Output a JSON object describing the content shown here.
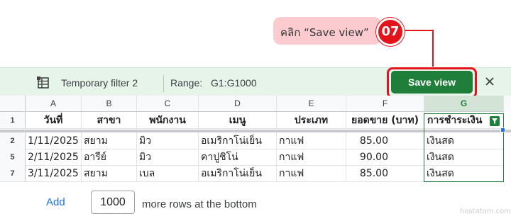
{
  "callout": {
    "text": "คลิก “Save view”",
    "step": "07"
  },
  "filter_bar": {
    "filter_name": "Temporary filter 2",
    "range_label": "Range:",
    "range_value": "G1:G1000",
    "save_label": "Save view"
  },
  "columns": [
    "A",
    "B",
    "C",
    "D",
    "E",
    "F",
    "G"
  ],
  "header_row": {
    "row_number": "1",
    "cells": [
      "วันที่",
      "สาขา",
      "พนักงาน",
      "เมนู",
      "ประเภท",
      "ยอดขาย (บาท)",
      "การชำระเงิน"
    ]
  },
  "rows": [
    {
      "row_number": "2",
      "cells": [
        "1/11/2025",
        "สยาม",
        "มิว",
        "อเมริกาโน่เย็น",
        "กาแฟ",
        "85.00",
        "เงินสด"
      ]
    },
    {
      "row_number": "5",
      "cells": [
        "2/11/2025",
        "อารีย์",
        "มิว",
        "คาปูชิโน่",
        "กาแฟ",
        "90.00",
        "เงินสด"
      ]
    },
    {
      "row_number": "7",
      "cells": [
        "3/11/2025",
        "สยาม",
        "เบล",
        "อเมริกาโน่เย็น",
        "กาแฟ",
        "85.00",
        "เงินสด"
      ]
    }
  ],
  "footer": {
    "add_label": "Add",
    "rows_value": "1000",
    "rows_suffix": "more rows at the bottom"
  },
  "watermark": "hostatom.com",
  "colors": {
    "accent_green": "#1e7e3a",
    "callout_red": "#e3141c",
    "callout_bg": "#fccbcf",
    "filter_bar_bg": "#e6f4ea"
  },
  "icons": {
    "filter_view": "table-grid-icon",
    "close": "close-icon",
    "column_filter": "filter-funnel-icon"
  }
}
